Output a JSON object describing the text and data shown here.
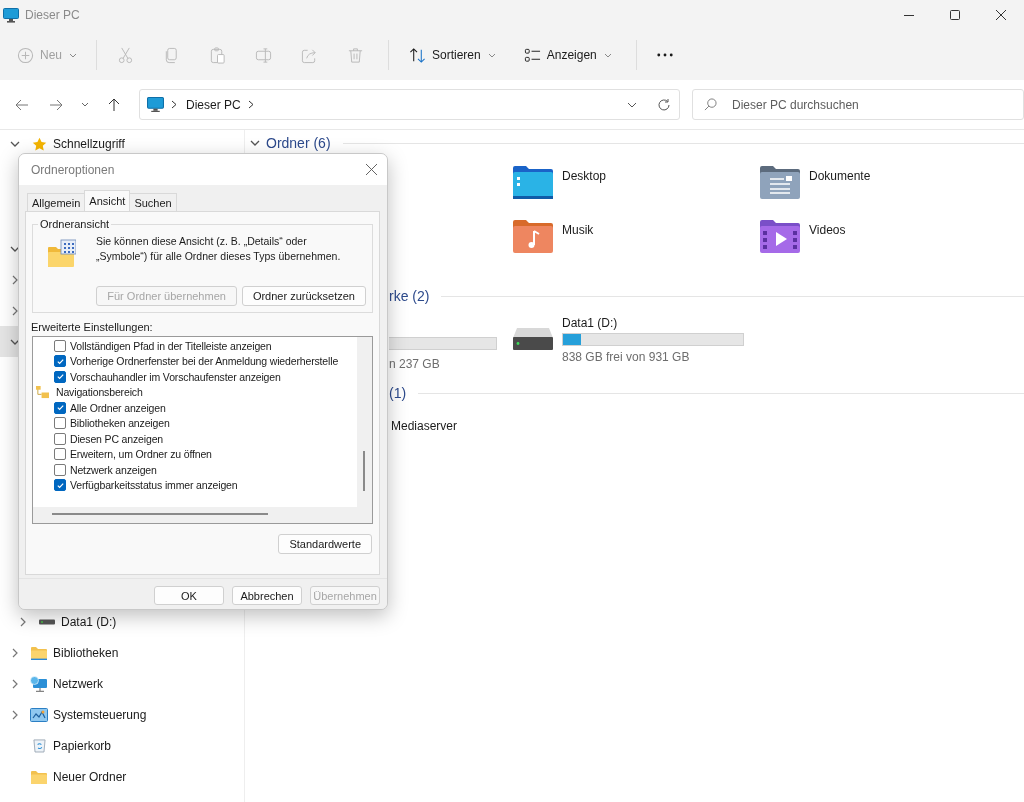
{
  "window": {
    "title": "Dieser PC"
  },
  "toolbar": [
    {
      "kind": "new",
      "label": "Neu",
      "disabled": true
    },
    {
      "kind": "cut",
      "disabled": true
    },
    {
      "kind": "copy",
      "disabled": true
    },
    {
      "kind": "paste",
      "disabled": true
    },
    {
      "kind": "rename",
      "disabled": true
    },
    {
      "kind": "share",
      "disabled": true
    },
    {
      "kind": "delete",
      "disabled": true
    },
    {
      "kind": "sort",
      "label": "Sortieren",
      "disabled": false
    },
    {
      "kind": "view",
      "label": "Anzeigen",
      "disabled": false
    },
    {
      "kind": "more",
      "disabled": false
    }
  ],
  "address": {
    "path": [
      "Dieser PC"
    ],
    "search_placeholder": "Dieser PC durchsuchen"
  },
  "sidebar": {
    "items": [
      {
        "kind": "star",
        "label": "Schnellzugriff",
        "expanded": true,
        "selected": false
      },
      {
        "kind": "hidden",
        "expanded": true,
        "selected": false
      },
      {
        "kind": "hidden",
        "expanded": false,
        "selected": false
      },
      {
        "kind": "hidden",
        "expanded": false,
        "selected": false
      },
      {
        "kind": "hidden",
        "expanded": true,
        "selected": true,
        "children": [
          {
            "kind": "drive",
            "label": "Data1 (D:)",
            "expanded": false,
            "selected": false
          }
        ]
      },
      {
        "kind": "library",
        "label": "Bibliotheken",
        "expanded": false,
        "selected": false
      },
      {
        "kind": "network",
        "label": "Netzwerk",
        "expanded": false,
        "selected": false
      },
      {
        "kind": "control-panel",
        "label": "Systemsteuerung",
        "expanded": false,
        "selected": false
      },
      {
        "kind": "recycle-bin",
        "label": "Papierkorb",
        "selected": false
      },
      {
        "kind": "folder",
        "label": "Neuer Ordner",
        "selected": false
      }
    ]
  },
  "content": {
    "sections": [
      {
        "kind": "folders",
        "title": "Ordner (6)",
        "expanded": true,
        "items": [
          {
            "kind": "desktop",
            "label": "Desktop"
          },
          {
            "kind": "documents",
            "label": "Dokumente"
          },
          {
            "kind": "music",
            "label": "Musik"
          },
          {
            "kind": "videos",
            "label": "Videos"
          }
        ]
      },
      {
        "kind": "drives",
        "title": "rke (2)",
        "items": [
          {
            "kind": "partial",
            "reading": "n 237 GB"
          },
          {
            "kind": "drive",
            "label": "Data1 (D:)",
            "level": 0.1,
            "reading": "838 GB frei von 931 GB"
          }
        ]
      },
      {
        "kind": "network",
        "title": "(1)",
        "items": [
          {
            "label": "Mediaserver"
          }
        ]
      }
    ]
  },
  "dialog": {
    "title": "Ordneroptionen",
    "tabs": [
      {
        "label": "Allgemein",
        "selected": false
      },
      {
        "label": "Ansicht",
        "selected": true
      },
      {
        "label": "Suchen",
        "selected": false
      }
    ],
    "group": {
      "title": "Ordneransicht",
      "text": "Sie können diese Ansicht (z. B. „Details“ oder „Symbole“) für alle Ordner dieses Typs übernehmen.",
      "buttons": [
        {
          "label": "Für Ordner übernehmen",
          "disabled": true
        },
        {
          "label": "Ordner zurücksetzen",
          "disabled": false
        }
      ]
    },
    "settings_label": "Erweiterte Einstellungen:",
    "settings": [
      {
        "kind": "checkbox",
        "label": "Vollständigen Pfad in der Titelleiste anzeigen",
        "checked": false
      },
      {
        "kind": "checkbox",
        "label": "Vorherige Ordnerfenster bei der Anmeldung wiederherstelle",
        "checked": true
      },
      {
        "kind": "checkbox",
        "label": "Vorschauhandler im Vorschaufenster anzeigen",
        "checked": true
      },
      {
        "kind": "category",
        "label": "Navigationsbereich"
      },
      {
        "kind": "checkbox",
        "label": "Alle Ordner anzeigen",
        "checked": true
      },
      {
        "kind": "checkbox",
        "label": "Bibliotheken anzeigen",
        "checked": false
      },
      {
        "kind": "checkbox",
        "label": "Diesen PC anzeigen",
        "checked": false
      },
      {
        "kind": "checkbox",
        "label": "Erweitern, um Ordner zu öffnen",
        "checked": false
      },
      {
        "kind": "checkbox",
        "label": "Netzwerk anzeigen",
        "checked": false
      },
      {
        "kind": "checkbox",
        "label": "Verfügbarkeitsstatus immer anzeigen",
        "checked": true
      }
    ],
    "defaults_button": "Standardwerte",
    "buttons": [
      {
        "label": "OK",
        "disabled": false
      },
      {
        "label": "Abbrechen",
        "disabled": false
      },
      {
        "label": "Übernehmen",
        "disabled": true
      }
    ]
  }
}
